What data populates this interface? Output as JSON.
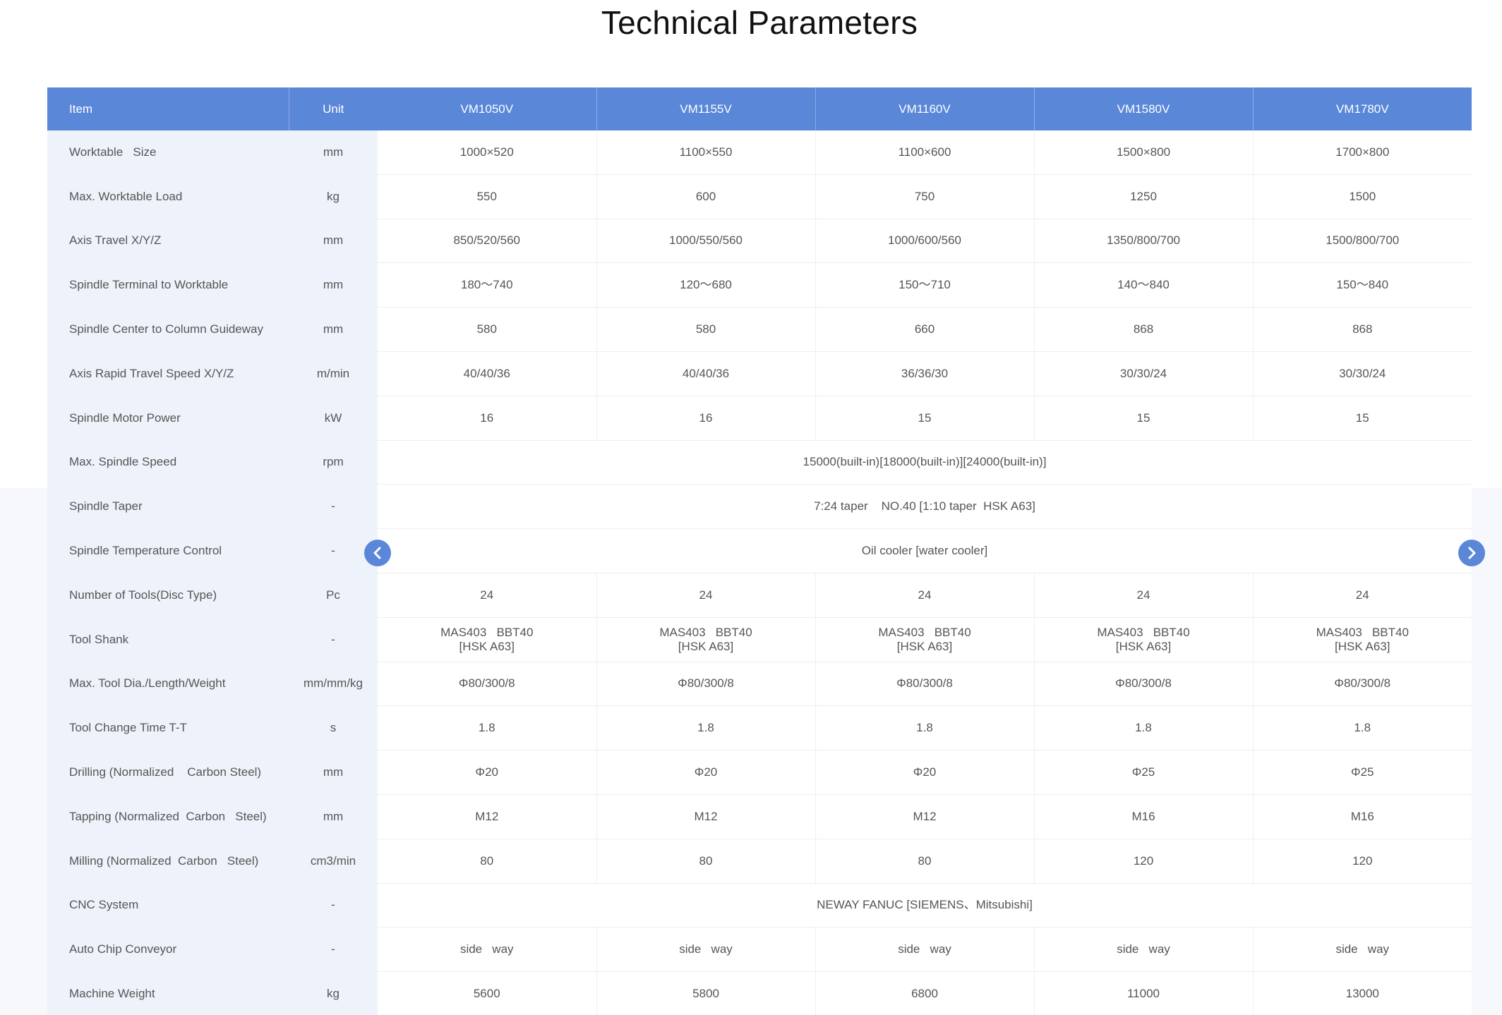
{
  "page": {
    "title": "Technical Parameters"
  },
  "table": {
    "headers": {
      "item": "Item",
      "unit": "Unit",
      "models": [
        "VM1050V",
        "VM1155V",
        "VM1160V",
        "VM1580V",
        "VM1780V"
      ]
    },
    "rows": [
      {
        "item": "Worktable   Size",
        "unit": "mm",
        "values": [
          "1000×520",
          "1100×550",
          "1100×600",
          "1500×800",
          "1700×800"
        ]
      },
      {
        "item": "Max. Worktable Load",
        "unit": "kg",
        "values": [
          "550",
          "600",
          "750",
          "1250",
          "1500"
        ]
      },
      {
        "item": "Axis Travel X/Y/Z",
        "unit": "mm",
        "values": [
          "850/520/560",
          "1000/550/560",
          "1000/600/560",
          "1350/800/700",
          "1500/800/700"
        ]
      },
      {
        "item": "Spindle Terminal to Worktable",
        "unit": "mm",
        "values": [
          "180～740",
          "120～680",
          "150～710",
          "140～840",
          "150～840"
        ]
      },
      {
        "item": "Spindle Center to Column Guideway",
        "unit": "mm",
        "values": [
          "580",
          "580",
          "660",
          "868",
          "868"
        ]
      },
      {
        "item": "Axis Rapid Travel Speed X/Y/Z",
        "unit": "m/min",
        "values": [
          "40/40/36",
          "40/40/36",
          "36/36/30",
          "30/30/24",
          "30/30/24"
        ]
      },
      {
        "item": "Spindle Motor Power",
        "unit": "kW",
        "values": [
          "16",
          "16",
          "15",
          "15",
          "15"
        ]
      },
      {
        "item": "Max. Spindle Speed",
        "unit": "rpm",
        "value": "15000(built-in)[18000(built-in)][24000(built-in)]"
      },
      {
        "item": "Spindle Taper",
        "unit": "-",
        "value": "7:24 taper    NO.40 [1:10 taper  HSK A63]"
      },
      {
        "item": "Spindle Temperature Control",
        "unit": "-",
        "value": "Oil cooler [water cooler]"
      },
      {
        "item": "Number of Tools(Disc Type)",
        "unit": "Pc",
        "values": [
          "24",
          "24",
          "24",
          "24",
          "24"
        ]
      },
      {
        "item": "Tool Shank",
        "unit": "-",
        "values": [
          "MAS403   BBT40\n[HSK A63]",
          "MAS403   BBT40\n[HSK A63]",
          "MAS403   BBT40\n[HSK A63]",
          "MAS403   BBT40\n[HSK A63]",
          "MAS403   BBT40\n[HSK A63]"
        ]
      },
      {
        "item": "Max. Tool Dia./Length/Weight",
        "unit": "mm/mm/kg",
        "values": [
          "Φ80/300/8",
          "Φ80/300/8",
          "Φ80/300/8",
          "Φ80/300/8",
          "Φ80/300/8"
        ]
      },
      {
        "item": "Tool Change Time T-T",
        "unit": "s",
        "values": [
          "1.8",
          "1.8",
          "1.8",
          "1.8",
          "1.8"
        ]
      },
      {
        "item": "Drilling (Normalized    Carbon Steel)",
        "unit": "mm",
        "values": [
          "Φ20",
          "Φ20",
          "Φ20",
          "Φ25",
          "Φ25"
        ]
      },
      {
        "item": "Tapping (Normalized  Carbon   Steel)",
        "unit": "mm",
        "values": [
          "M12",
          "M12",
          "M12",
          "M16",
          "M16"
        ]
      },
      {
        "item": "Milling (Normalized  Carbon   Steel)",
        "unit": "cm3/min",
        "values": [
          "80",
          "80",
          "80",
          "120",
          "120"
        ]
      },
      {
        "item": "CNC System",
        "unit": "-",
        "value": "NEWAY FANUC [SIEMENS、Mitsubishi]"
      },
      {
        "item": "Auto Chip Conveyor",
        "unit": "-",
        "values": [
          "side   way",
          "side   way",
          "side   way",
          "side   way",
          "side   way"
        ]
      },
      {
        "item": "Machine Weight",
        "unit": "kg",
        "values": [
          "5600",
          "5800",
          "6800",
          "11000",
          "13000"
        ]
      }
    ]
  },
  "nav": {
    "prev_icon": "chevron-left-icon",
    "next_icon": "chevron-right-icon"
  },
  "colors": {
    "header_bg": "#5b87d9",
    "label_bg": "#eef3fb",
    "page_bg_lower": "#f6f8fc"
  }
}
